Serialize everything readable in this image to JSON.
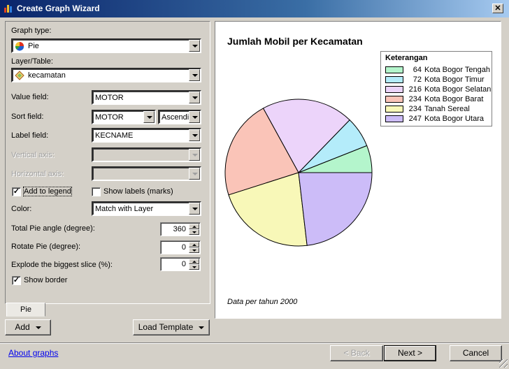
{
  "window": {
    "title": "Create Graph Wizard",
    "close_icon": "close-icon"
  },
  "form": {
    "graph_type_label": "Graph type:",
    "graph_type_value": "Pie",
    "layer_label": "Layer/Table:",
    "layer_value": "kecamatan",
    "value_field_label": "Value field:",
    "value_field_value": "MOTOR",
    "sort_field_label": "Sort field:",
    "sort_field_value": "MOTOR",
    "sort_order_value": "Ascendir",
    "label_field_label": "Label field:",
    "label_field_value": "KECNAME",
    "vertical_axis_label": "Vertical axis:",
    "vertical_axis_value": "",
    "horizontal_axis_label": "Horizontal axis:",
    "horizontal_axis_value": "",
    "add_to_legend_label": "Add to legend",
    "add_to_legend_checked": true,
    "show_labels_label": "Show labels (marks)",
    "show_labels_checked": false,
    "color_label": "Color:",
    "color_value": "Match with Layer",
    "total_angle_label": "Total Pie angle (degree):",
    "total_angle_value": "360",
    "rotate_label": "Rotate Pie (degree):",
    "rotate_value": "0",
    "explode_label": "Explode the biggest slice (%):",
    "explode_value": "0",
    "show_border_label": "Show border",
    "show_border_checked": true
  },
  "tabs": [
    {
      "label": "Pie"
    }
  ],
  "buttons": {
    "add": "Add",
    "load_template": "Load Template",
    "back": "< Back",
    "next": "Next >",
    "cancel": "Cancel"
  },
  "link_about": "About graphs",
  "chart_data": {
    "type": "pie",
    "title": "Jumlah Mobil per Kecamatan",
    "footnote": "Data per tahun 2000",
    "legend_title": "Keterangan",
    "legend_position": "top-right",
    "categories": [
      "Kota Bogor Tengah",
      "Kota Bogor Timur",
      "Kota Bogor Selatan",
      "Kota Bogor Barat",
      "Tanah Sereal",
      "Kota Bogor Utara"
    ],
    "values": [
      64,
      72,
      216,
      234,
      234,
      247
    ],
    "colors": [
      "#b4f5cc",
      "#b4ecfa",
      "#ecd4fa",
      "#fac4b8",
      "#f8f8b8",
      "#ccbcf8"
    ],
    "start_angle_deg": 0,
    "direction": "counter-clockwise"
  }
}
